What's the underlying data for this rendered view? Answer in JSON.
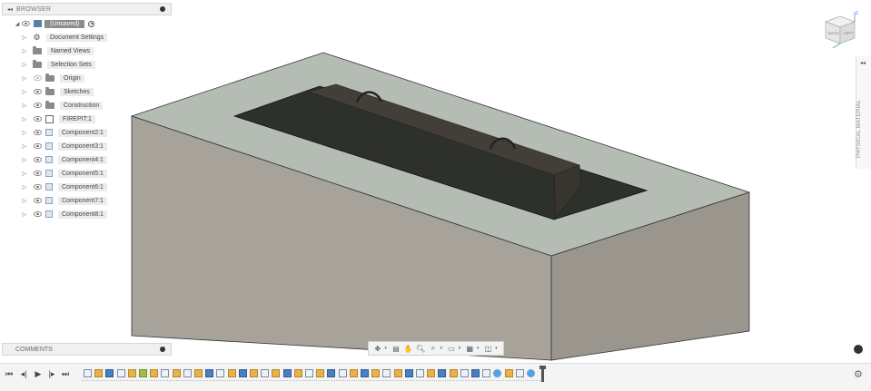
{
  "browser": {
    "title": "BROWSER",
    "collapse_icon": "double-chevron-left-icon",
    "root": {
      "label": "(Unsaved)"
    },
    "items": [
      {
        "label": "Document Settings",
        "icon": "gear-icon",
        "eye": false
      },
      {
        "label": "Named Views",
        "icon": "folder-icon",
        "eye": false
      },
      {
        "label": "Selection Sets",
        "icon": "folder-icon",
        "eye": false
      },
      {
        "label": "Origin",
        "icon": "folder-icon",
        "eye": "hidden"
      },
      {
        "label": "Sketches",
        "icon": "folder-icon",
        "eye": true
      },
      {
        "label": "Construction",
        "icon": "folder-icon",
        "eye": true
      },
      {
        "label": "FIREPIT:1",
        "icon": "sketch-icon",
        "eye": true
      },
      {
        "label": "Component2:1",
        "icon": "component-icon",
        "eye": true
      },
      {
        "label": "Component3:1",
        "icon": "component-icon",
        "eye": true
      },
      {
        "label": "Component4:1",
        "icon": "component-icon",
        "eye": true
      },
      {
        "label": "Component5:1",
        "icon": "component-icon",
        "eye": true
      },
      {
        "label": "Component6:1",
        "icon": "component-icon",
        "eye": true
      },
      {
        "label": "Component7:1",
        "icon": "component-icon",
        "eye": true
      },
      {
        "label": "Component8:1",
        "icon": "component-icon",
        "eye": true
      }
    ]
  },
  "comments": {
    "title": "COMMENTS"
  },
  "right_panel": {
    "label": "PHYSICAL MATERIAL"
  },
  "viewcube": {
    "front": "BACK",
    "side": "LEFT",
    "axis": "Z"
  },
  "navbar": {
    "tools": [
      "orbit-icon",
      "look-at-icon",
      "pan-icon",
      "zoom-icon",
      "zoom-window-icon",
      "display-settings-icon",
      "grid-icon",
      "viewports-icon"
    ]
  },
  "colors": {
    "slab_top": "#b4bcb4",
    "slab_front": "#a8a49c",
    "slab_side": "#9a968e",
    "burner": "#2e302c",
    "burner_edge": "#44403a"
  }
}
